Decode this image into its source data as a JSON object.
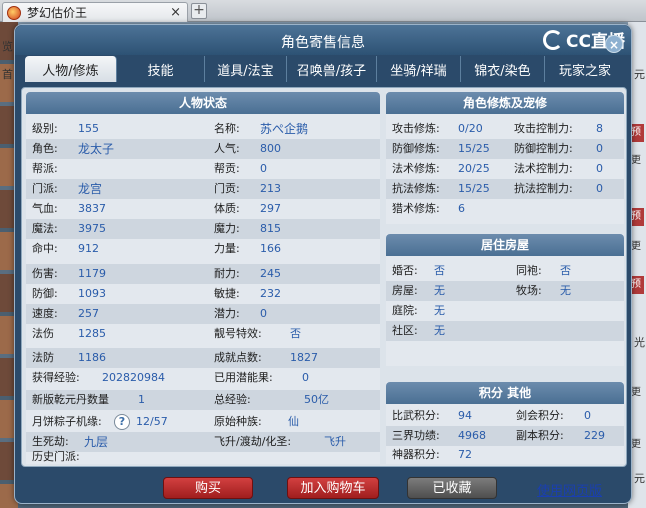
{
  "browser": {
    "tab_title": "梦幻估价王",
    "close_glyph": "×",
    "new_tab_glyph": "+"
  },
  "background": {
    "left_texts": [
      "览",
      "首"
    ],
    "right_tags": [
      "预",
      "更",
      "预",
      "更",
      "预",
      "更",
      "更"
    ],
    "right_texts": [
      "元",
      "光",
      "元"
    ]
  },
  "dialog": {
    "title": "角色寄售信息",
    "brand": "CC直播",
    "close": "×",
    "tabs": [
      "人物/修炼",
      "技能",
      "道具/法宝",
      "召唤兽/孩子",
      "坐骑/祥瑞",
      "锦衣/染色",
      "玩家之家"
    ]
  },
  "character": {
    "header": "人物状态",
    "left": [
      {
        "label": "级别:",
        "value": "155"
      },
      {
        "label": "角色:",
        "value": "龙太子"
      },
      {
        "label": "帮派:",
        "value": ""
      },
      {
        "label": "门派:",
        "value": "龙宫"
      },
      {
        "label": "气血:",
        "value": "3837"
      },
      {
        "label": "魔法:",
        "value": "3975"
      },
      {
        "label": "命中:",
        "value": "912"
      },
      {
        "label": "伤害:",
        "value": "1179"
      },
      {
        "label": "防御:",
        "value": "1093"
      },
      {
        "label": "速度:",
        "value": "257"
      },
      {
        "label": "法伤",
        "value": "1285"
      },
      {
        "label": "法防",
        "value": "1186"
      },
      {
        "label": "获得经验:",
        "value": "202820984"
      },
      {
        "label": "新版乾元丹数量",
        "value": "1"
      },
      {
        "label": "月饼粽子机缘:",
        "value": "12/57"
      },
      {
        "label": "生死劫:",
        "value": "九层"
      },
      {
        "label": "历史门派:",
        "value": ""
      }
    ],
    "right": [
      {
        "label": "名称:",
        "value": "苏ぺ企鹅"
      },
      {
        "label": "人气:",
        "value": "800"
      },
      {
        "label": "帮贡:",
        "value": "0"
      },
      {
        "label": "门贡:",
        "value": "213"
      },
      {
        "label": "体质:",
        "value": "297"
      },
      {
        "label": "魔力:",
        "value": "815"
      },
      {
        "label": "力量:",
        "value": "166"
      },
      {
        "label": "耐力:",
        "value": "245"
      },
      {
        "label": "敏捷:",
        "value": "232"
      },
      {
        "label": "潜力:",
        "value": "0"
      },
      {
        "label": "靓号特效:",
        "value": "否"
      },
      {
        "label": "成就点数:",
        "value": "1827"
      },
      {
        "label": "已用潜能果:",
        "value": "0"
      },
      {
        "label": "总经验:",
        "value": "50亿"
      },
      {
        "label": "原始种族:",
        "value": "仙"
      },
      {
        "label": "飞升/渡劫/化圣:",
        "value": "飞升"
      }
    ],
    "help_glyph": "?"
  },
  "cultivation": {
    "header": "角色修炼及宠修",
    "rows": [
      {
        "l1": "攻击修炼:",
        "v1": "0/20",
        "l2": "攻击控制力:",
        "v2": "8"
      },
      {
        "l1": "防御修炼:",
        "v1": "15/25",
        "l2": "防御控制力:",
        "v2": "0"
      },
      {
        "l1": "法术修炼:",
        "v1": "20/25",
        "l2": "法术控制力:",
        "v2": "0"
      },
      {
        "l1": "抗法修炼:",
        "v1": "15/25",
        "l2": "抗法控制力:",
        "v2": "0"
      },
      {
        "l1": "猎术修炼:",
        "v1": "6",
        "l2": "",
        "v2": ""
      }
    ]
  },
  "housing": {
    "header": "居住房屋",
    "rows": [
      {
        "l1": "婚否:",
        "v1": "否",
        "l2": "同袍:",
        "v2": "否"
      },
      {
        "l1": "房屋:",
        "v1": "无",
        "l2": "牧场:",
        "v2": "无"
      },
      {
        "l1": "庭院:",
        "v1": "无",
        "l2": "",
        "v2": ""
      },
      {
        "l1": "社区:",
        "v1": "无",
        "l2": "",
        "v2": ""
      }
    ]
  },
  "points": {
    "header": "积分 其他",
    "rows": [
      {
        "l1": "比武积分:",
        "v1": "94",
        "l2": "剑会积分:",
        "v2": "0"
      },
      {
        "l1": "三界功绩:",
        "v1": "4968",
        "l2": "副本积分:",
        "v2": "229"
      },
      {
        "l1": "神器积分:",
        "v1": "72",
        "l2": "",
        "v2": ""
      }
    ]
  },
  "footer": {
    "buy": "购买",
    "add_cart": "加入购物车",
    "favorited": "已收藏",
    "web_version": "使用网页版"
  },
  "colors": {
    "dialog_bg": "#2b4a6a",
    "header_blue": "#4a6f93",
    "value_blue": "#2a5caa",
    "button_red": "#b82a2a",
    "button_gray": "#5a5a5a"
  }
}
